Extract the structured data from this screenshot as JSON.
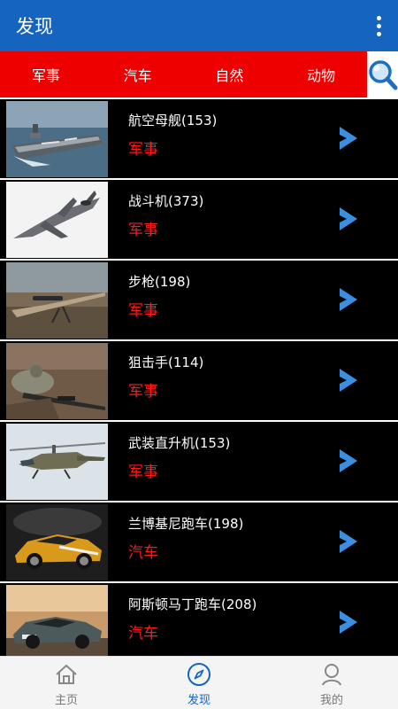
{
  "appbar": {
    "title": "发现",
    "menu_icon": "more-vert-icon"
  },
  "tabs": [
    {
      "label": "军事"
    },
    {
      "label": "汽车"
    },
    {
      "label": "自然"
    },
    {
      "label": "动物"
    }
  ],
  "search": {
    "icon": "search-icon"
  },
  "items": [
    {
      "title": "航空母舰(153)",
      "category": "军事",
      "thumb": "aircraft-carrier-photo"
    },
    {
      "title": "战斗机(373)",
      "category": "军事",
      "thumb": "fighter-jet-photo"
    },
    {
      "title": "步枪(198)",
      "category": "军事",
      "thumb": "rifle-photo"
    },
    {
      "title": "狙击手(114)",
      "category": "军事",
      "thumb": "sniper-photo"
    },
    {
      "title": "武装直升机(153)",
      "category": "军事",
      "thumb": "attack-helicopter-photo"
    },
    {
      "title": "兰博基尼跑车(198)",
      "category": "汽车",
      "thumb": "lamborghini-photo"
    },
    {
      "title": "阿斯顿马丁跑车(208)",
      "category": "汽车",
      "thumb": "aston-martin-photo"
    }
  ],
  "bottom_nav": [
    {
      "label": "主页",
      "icon": "home-icon"
    },
    {
      "label": "发现",
      "icon": "compass-icon",
      "active": true
    },
    {
      "label": "我的",
      "icon": "person-icon"
    }
  ],
  "colors": {
    "appbar": "#1565c0",
    "tab_strip": "#ef0000",
    "category_text": "#ff1a1a",
    "arrow": "#3b8fe0",
    "active_nav": "#1565c0"
  }
}
